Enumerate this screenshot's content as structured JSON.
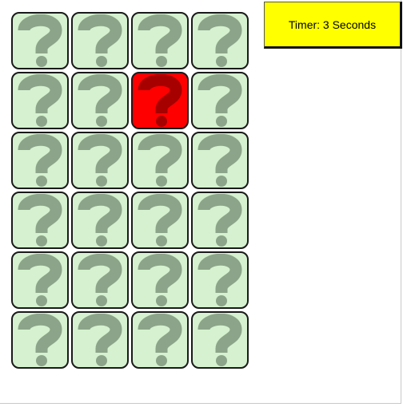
{
  "timer": {
    "label": "Timer: 3 Seconds"
  },
  "board": {
    "rows": 6,
    "columns": 4,
    "card_symbol": "?",
    "icon": "question-mark-icon",
    "selected_card": {
      "row": 2,
      "column": 3
    },
    "colors": {
      "card_face": "#d5f1cf",
      "card_symbol": "#8ca489",
      "selected_face": "#ff0000",
      "selected_symbol": "#a60000",
      "timer_background": "#ffff00"
    }
  }
}
